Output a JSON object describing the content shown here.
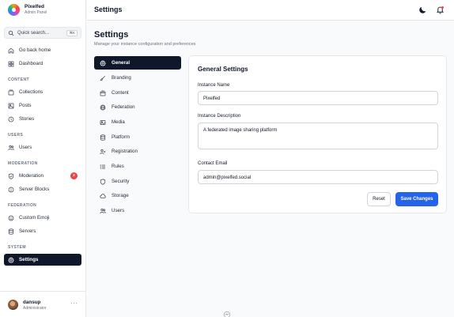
{
  "brand": {
    "name": "Pixelfed",
    "subtitle": "Admin Panel"
  },
  "search": {
    "placeholder": "Quick search...",
    "shortcut": "⌘K"
  },
  "sidebar": {
    "top_items": [
      {
        "label": "Go back home",
        "icon": "home-icon"
      },
      {
        "label": "Dashboard",
        "icon": "dashboard-icon"
      }
    ],
    "sections": [
      {
        "title": "CONTENT",
        "items": [
          {
            "label": "Collections",
            "icon": "collections-icon"
          },
          {
            "label": "Posts",
            "icon": "posts-icon"
          },
          {
            "label": "Stories",
            "icon": "stories-icon"
          }
        ]
      },
      {
        "title": "USERS",
        "items": [
          {
            "label": "Users",
            "icon": "users-icon"
          }
        ]
      },
      {
        "title": "MODERATION",
        "items": [
          {
            "label": "Moderation",
            "icon": "shield-icon",
            "badge": "2"
          },
          {
            "label": "Server Blocks",
            "icon": "block-icon"
          }
        ]
      },
      {
        "title": "FEDERATION",
        "items": [
          {
            "label": "Custom Emoji",
            "icon": "emoji-icon"
          },
          {
            "label": "Servers",
            "icon": "servers-icon"
          }
        ]
      },
      {
        "title": "SYSTEM",
        "items": [
          {
            "label": "Settings",
            "icon": "gear-icon",
            "active": true
          }
        ]
      }
    ]
  },
  "user": {
    "name": "dansup",
    "role": "Administrator",
    "more": "···"
  },
  "topbar": {
    "title": "Settings",
    "icons": [
      "moon-icon",
      "bell-icon"
    ]
  },
  "page": {
    "title": "Settings",
    "subtitle": "Manage your instance configuration and preferences"
  },
  "settings_nav": [
    {
      "label": "General",
      "icon": "gear-icon",
      "active": true
    },
    {
      "label": "Branding",
      "icon": "brush-icon"
    },
    {
      "label": "Content",
      "icon": "content-icon"
    },
    {
      "label": "Federation",
      "icon": "globe-icon"
    },
    {
      "label": "Media",
      "icon": "media-icon"
    },
    {
      "label": "Platform",
      "icon": "database-icon"
    },
    {
      "label": "Registration",
      "icon": "user-plus-icon"
    },
    {
      "label": "Rules",
      "icon": "list-icon"
    },
    {
      "label": "Security",
      "icon": "shield-icon"
    },
    {
      "label": "Storage",
      "icon": "cloud-icon"
    },
    {
      "label": "Users",
      "icon": "users-icon"
    }
  ],
  "form": {
    "title": "General Settings",
    "instance_name": {
      "label": "Instance Name",
      "value": "Pixelfed"
    },
    "instance_description": {
      "label": "Instance Description",
      "value": "A federated image sharing platform"
    },
    "contact_email": {
      "label": "Contact Email",
      "value": "admin@pixelfed.social"
    },
    "reset_label": "Reset",
    "save_label": "Save Changes"
  },
  "colors": {
    "active_bg": "#0f172a",
    "primary": "#2563eb",
    "badge": "#ef4444"
  }
}
